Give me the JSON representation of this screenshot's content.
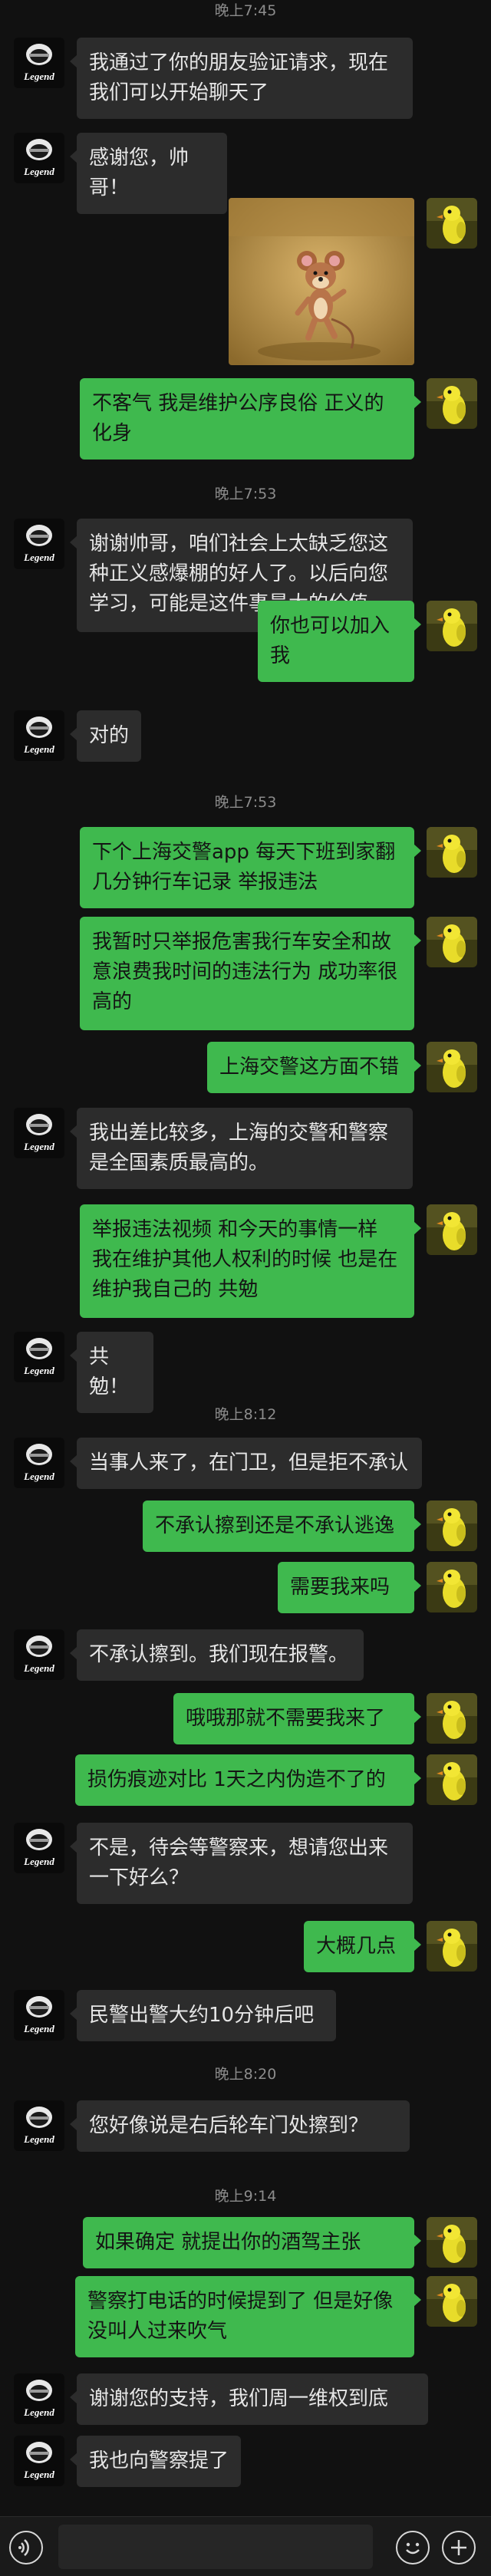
{
  "colors": {
    "background": "#111111",
    "bubble_self": "#3fb94e",
    "bubble_other": "#2c2c2c",
    "timestamp": "#8c8c8c"
  },
  "avatars": {
    "other_label": "Legend",
    "self_icon": "yellow-bird-avatar"
  },
  "sticker": {
    "icon": "cartoon-mouse-sticker"
  },
  "messages": [
    {
      "type": "time",
      "text": "晚上7:45"
    },
    {
      "type": "text",
      "from": "other",
      "text": "我通过了你的朋友验证请求，现在我们可以开始聊天了"
    },
    {
      "type": "text",
      "from": "other",
      "text": "感谢您，帅哥！"
    },
    {
      "type": "sticker",
      "from": "self"
    },
    {
      "type": "text",
      "from": "self",
      "text": "不客气 我是维护公序良俗 正义的化身"
    },
    {
      "type": "time",
      "text": "晚上7:53"
    },
    {
      "type": "text",
      "from": "other",
      "text": "谢谢帅哥，咱们社会上太缺乏您这种正义感爆棚的好人了。以后向您学习，可能是这件事最大的价值。"
    },
    {
      "type": "text",
      "from": "self",
      "text": "你也可以加入我"
    },
    {
      "type": "text",
      "from": "other",
      "text": "对的"
    },
    {
      "type": "time",
      "text": "晚上7:53"
    },
    {
      "type": "text",
      "from": "self",
      "text": "下个上海交警app 每天下班到家翻几分钟行车记录 举报违法"
    },
    {
      "type": "text",
      "from": "self",
      "text": "我暂时只举报危害我行车安全和故意浪费我时间的违法行为 成功率很高的"
    },
    {
      "type": "text",
      "from": "self",
      "text": "上海交警这方面不错"
    },
    {
      "type": "text",
      "from": "other",
      "text": "我出差比较多，上海的交警和警察是全国素质最高的。"
    },
    {
      "type": "text",
      "from": "self",
      "text": "举报违法视频 和今天的事情一样 我在维护其他人权利的时候 也是在维护我自己的 共勉"
    },
    {
      "type": "text",
      "from": "other",
      "text": "共勉！"
    },
    {
      "type": "time",
      "text": "晚上8:12"
    },
    {
      "type": "text",
      "from": "other",
      "text": "当事人来了，在门卫，但是拒不承认"
    },
    {
      "type": "text",
      "from": "self",
      "text": "不承认擦到还是不承认逃逸"
    },
    {
      "type": "text",
      "from": "self",
      "text": "需要我来吗"
    },
    {
      "type": "text",
      "from": "other",
      "text": "不承认擦到。我们现在报警。"
    },
    {
      "type": "text",
      "from": "self",
      "text": "哦哦那就不需要我来了"
    },
    {
      "type": "text",
      "from": "self",
      "text": "损伤痕迹对比 1天之内伪造不了的"
    },
    {
      "type": "text",
      "from": "other",
      "text": "不是，待会等警察来，想请您出来一下好么？"
    },
    {
      "type": "text",
      "from": "self",
      "text": "大概几点"
    },
    {
      "type": "text",
      "from": "other",
      "text": "民警出警大约10分钟后吧"
    },
    {
      "type": "time",
      "text": "晚上8:20"
    },
    {
      "type": "text",
      "from": "other",
      "text": "您好像说是右后轮车门处擦到？"
    },
    {
      "type": "time",
      "text": "晚上9:14"
    },
    {
      "type": "text",
      "from": "self",
      "text": "如果确定 就提出你的酒驾主张"
    },
    {
      "type": "text",
      "from": "self",
      "text": "警察打电话的时候提到了 但是好像没叫人过来吹气"
    },
    {
      "type": "text",
      "from": "other",
      "text": "谢谢您的支持，我们周一维权到底"
    },
    {
      "type": "text",
      "from": "other",
      "text": "我也向警察提了"
    }
  ],
  "input_bar": {
    "voice_icon": "voice-icon",
    "emoji_icon": "emoji-icon",
    "plus_icon": "plus-icon",
    "value": ""
  }
}
